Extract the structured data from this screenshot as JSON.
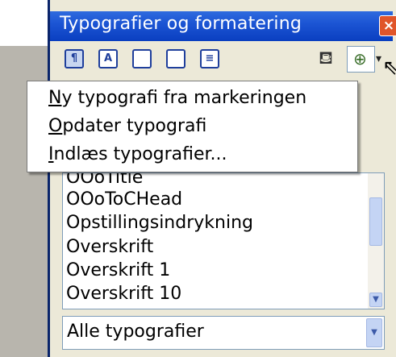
{
  "window": {
    "title": "Typografier og formatering",
    "close_label": "×"
  },
  "toolbar": {
    "buttons": [
      {
        "name": "paragraph-styles",
        "glyph": "¶"
      },
      {
        "name": "character-styles",
        "glyph": "A"
      },
      {
        "name": "frame-styles",
        "glyph": ""
      },
      {
        "name": "page-styles",
        "glyph": ""
      },
      {
        "name": "list-styles",
        "glyph": "≡"
      }
    ],
    "fill_format_glyph": "⛾",
    "new_style_glyph": "⊕",
    "dropdown_glyph": "▾"
  },
  "menu": {
    "items": [
      {
        "underlined": "N",
        "rest": "y typografi fra markeringen"
      },
      {
        "underlined": "O",
        "rest": "pdater typografi"
      },
      {
        "underlined": "I",
        "rest": "ndlæs typografier..."
      }
    ]
  },
  "style_list": {
    "items": [
      "OOoTitle",
      "OOoToCHead",
      "Opstillingsindrykning",
      "Overskrift",
      "Overskrift 1",
      "Overskrift 10"
    ]
  },
  "filter": {
    "selected": "Alle typografier"
  }
}
